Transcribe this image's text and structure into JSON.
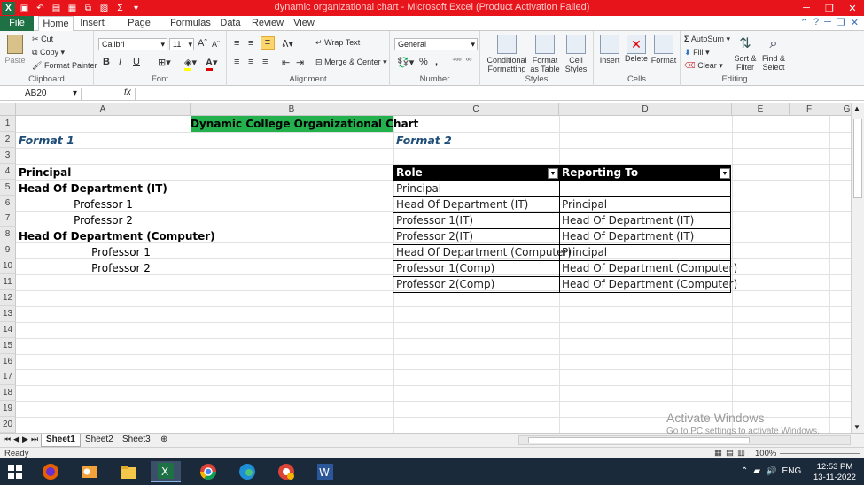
{
  "window": {
    "title": "dynamic organizational chart - Microsoft Excel (Product Activation Failed)"
  },
  "tabs": [
    "File",
    "Home",
    "Insert",
    "Page Layout",
    "Formulas",
    "Data",
    "Review",
    "View"
  ],
  "ribbon": {
    "clipboard": {
      "paste": "Paste",
      "cut": "Cut",
      "copy": "Copy",
      "format_painter": "Format Painter",
      "label": "Clipboard"
    },
    "font": {
      "name": "Calibri",
      "size": "11",
      "bold": "B",
      "italic": "I",
      "underline": "U",
      "grow": "A",
      "shrink": "A",
      "label": "Font"
    },
    "alignment": {
      "wrap": "Wrap Text",
      "merge": "Merge & Center",
      "label": "Alignment"
    },
    "number": {
      "format": "General",
      "percent": "%",
      "comma": ",",
      "label": "Number"
    },
    "styles": {
      "conditional": "Conditional Formatting",
      "table": "Format as Table",
      "cell": "Cell Styles",
      "label": "Styles"
    },
    "cells": {
      "insert": "Insert",
      "delete": "Delete",
      "format": "Format",
      "label": "Cells"
    },
    "editing": {
      "autosum": "AutoSum",
      "fill": "Fill",
      "clear": "Clear",
      "sort": "Sort & Filter",
      "find": "Find & Select",
      "label": "Editing"
    }
  },
  "formula_bar": {
    "name_box": "AB20",
    "fx": "fx",
    "content": ""
  },
  "columns": [
    "A",
    "B",
    "C",
    "D",
    "E",
    "F",
    "G"
  ],
  "rows": [
    "1",
    "2",
    "3",
    "4",
    "5",
    "6",
    "7",
    "8",
    "9",
    "10",
    "11",
    "12",
    "13",
    "14",
    "15",
    "16",
    "17",
    "18",
    "19",
    "20",
    "21"
  ],
  "sheet": {
    "title": "Dynamic College Organizational Chart",
    "format1_label": "Format 1",
    "format2_label": "Format 2",
    "format1_items": [
      {
        "text": "Principal",
        "bold": true
      },
      {
        "text": "Head Of Department (IT)",
        "bold": true
      },
      {
        "text": "Professor 1",
        "bold": false
      },
      {
        "text": "Professor 2",
        "bold": false
      },
      {
        "text": "Head Of Department (Computer)",
        "bold": true
      },
      {
        "text": "Professor 1",
        "bold": false
      },
      {
        "text": "Professor 2",
        "bold": false
      }
    ],
    "table": {
      "headers": [
        "Role",
        "Reporting To"
      ],
      "rows": [
        [
          "Principal",
          ""
        ],
        [
          "Head Of Department (IT)",
          "Principal"
        ],
        [
          "Professor 1(IT)",
          "Head Of Department (IT)"
        ],
        [
          "Professor 2(IT)",
          "Head Of Department (IT)"
        ],
        [
          "Head Of Department (Computer)",
          "Principal"
        ],
        [
          "Professor 1(Comp)",
          "Head Of Department (Computer)"
        ],
        [
          "Professor 2(Comp)",
          "Head Of Department (Computer)"
        ]
      ]
    }
  },
  "sheet_tabs": [
    "Sheet1",
    "Sheet2",
    "Sheet3"
  ],
  "status": {
    "ready": "Ready",
    "zoom": "100%"
  },
  "activation": {
    "line1": "Activate Windows",
    "line2": "Go to PC settings to activate Windows."
  },
  "clock": {
    "time": "12:53 PM",
    "date": "13-11-2022",
    "lang": "ENG"
  },
  "colors": {
    "title_bar": "#e8141b",
    "file_tab": "#1e7145",
    "title_cell": "#22b14c",
    "format_label": "#1f4e79",
    "table_header": "#000000"
  }
}
